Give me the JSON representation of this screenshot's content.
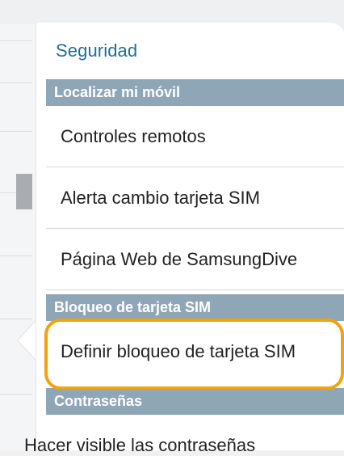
{
  "screen": {
    "title": "Seguridad",
    "sections": [
      {
        "header": "Localizar mi móvil",
        "items": [
          "Controles remotos",
          "Alerta cambio tarjeta SIM",
          "Página Web de SamsungDive"
        ]
      },
      {
        "header": "Bloqueo de tarjeta SIM",
        "items": [
          "Definir bloqueo de tarjeta SIM"
        ]
      },
      {
        "header": "Contraseñas",
        "items": [
          "Hacer visible las contraseñas"
        ]
      }
    ],
    "highlight": {
      "color": "#f2a20b"
    }
  }
}
